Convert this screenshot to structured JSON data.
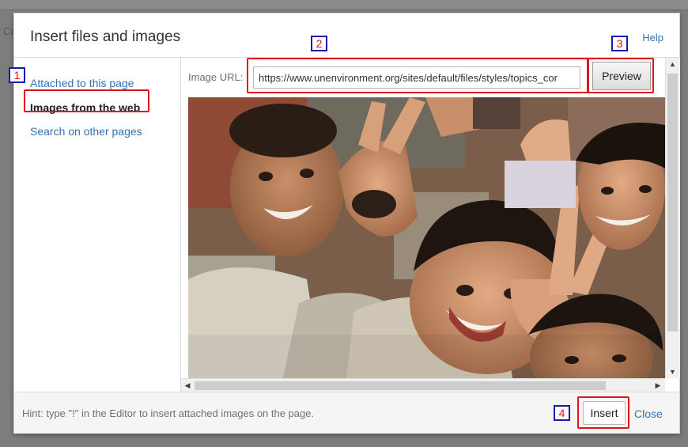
{
  "backdrop": {
    "fragment": "Co"
  },
  "dialog": {
    "title": "Insert files and images",
    "help_label": "Help"
  },
  "sidebar": {
    "items": [
      {
        "label": "Attached to this page",
        "active": false
      },
      {
        "label": "Images from the web",
        "active": true
      },
      {
        "label": "Search on other pages",
        "active": false
      }
    ]
  },
  "url_form": {
    "label": "Image URL:",
    "value": "https://www.unenvironment.org/sites/default/files/styles/topics_cor",
    "preview_label": "Preview"
  },
  "preview_image": {
    "subject": "photo-children-smiling-peace-signs"
  },
  "footer": {
    "hint": "Hint: type \"!\" in the Editor to insert attached images on the page.",
    "insert_label": "Insert",
    "close_label": "Close"
  },
  "callouts": {
    "n1": "1",
    "n2": "2",
    "n3": "3",
    "n4": "4"
  },
  "colors": {
    "link": "#3572b0",
    "callout_border": "#e0141e",
    "badge_border": "#1a1ab0",
    "badge_text": "#e0141e"
  }
}
